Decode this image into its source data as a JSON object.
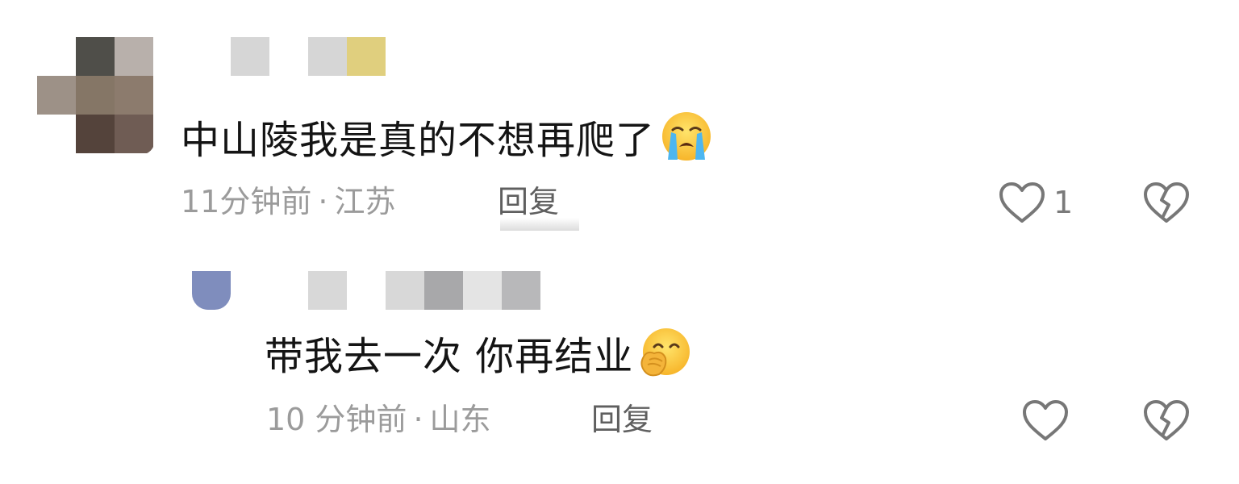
{
  "comments": [
    {
      "text": "中山陵我是真的不想再爬了",
      "emoji": "loudly-crying-face",
      "time": "11分钟前",
      "separator": "·",
      "location": "江苏",
      "reply_label": "回复",
      "like_count": "1",
      "avatar_mosaic": [
        "#ffffff",
        "#4f4e49",
        "#b8b0ab",
        "#9d9187",
        "#857666",
        "#8c7b6d",
        "#ffffff",
        "#54433b",
        "#6f5c54"
      ],
      "name_mosaic": [
        "#d6d6d6",
        "#ffffff",
        "#d6d6d6",
        "#e0cf7e"
      ]
    },
    {
      "text": "带我去一次 你再结业",
      "emoji": "face-with-hand-over-mouth",
      "time": "10 分钟前",
      "separator": "·",
      "location": "山东",
      "reply_label": "回复",
      "like_count": "",
      "avatar_mosaic": [
        "#7f8dbd"
      ],
      "name_mosaic": [
        "#d8d8d8",
        "#ffffff",
        "#d8d8d8",
        "#a8a8aa",
        "#e4e4e4",
        "#b8b8ba"
      ]
    }
  ],
  "icons": {
    "like": "heart-outline-icon",
    "dislike": "broken-heart-icon"
  }
}
